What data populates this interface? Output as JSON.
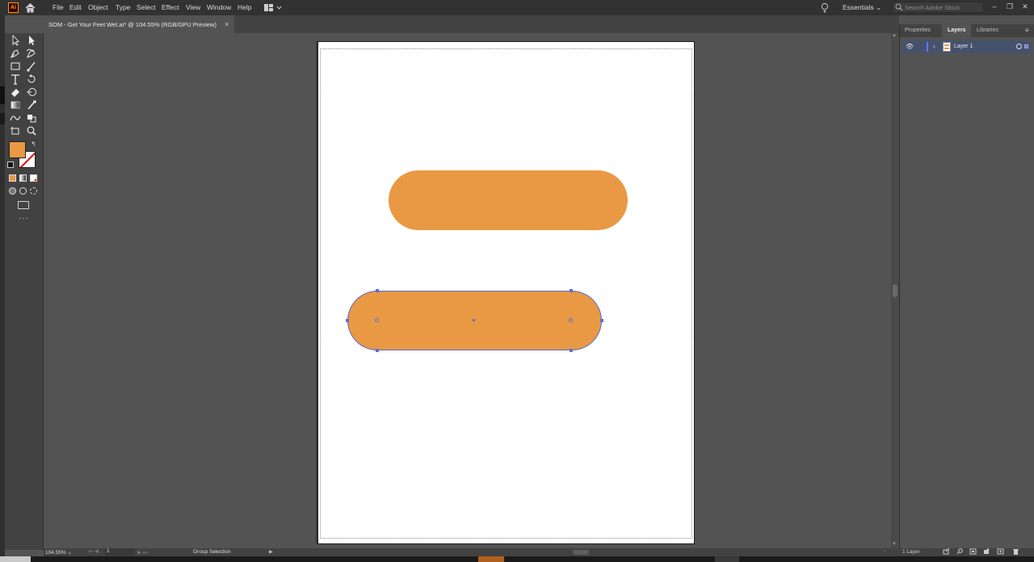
{
  "app": {
    "logo_text": "Ai",
    "menus": [
      "File",
      "Edit",
      "Object",
      "Type",
      "Select",
      "Effect",
      "View",
      "Window",
      "Help"
    ],
    "workspace": "Essentials",
    "stock_search_placeholder": "Search Adobe Stock"
  },
  "document": {
    "tab_title": "SOM - Get Your Feet Wet.ai* @ 104.55% (RGB/GPU Preview)",
    "close_glyph": "×"
  },
  "panel": {
    "tabs": [
      "Properties",
      "Layers",
      "Libraries"
    ],
    "active_tab": "Layers",
    "layers": [
      {
        "name": "Layer 1",
        "visible": true
      }
    ],
    "layer_count": "1 Layer"
  },
  "statusbar": {
    "zoom": "104.55%",
    "artboard": "1",
    "status": "Group Selection"
  },
  "artwork": {
    "fill_color": "#e99943",
    "selection_color": "#5b6fd6",
    "shapes": [
      "rounded-rectangle",
      "rounded-rectangle-selected"
    ]
  }
}
